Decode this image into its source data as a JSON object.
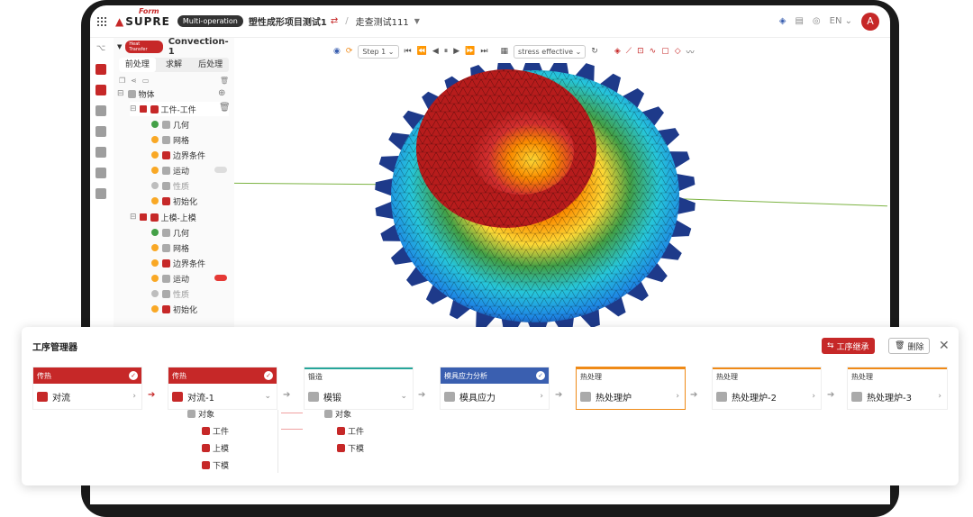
{
  "topbar": {
    "logo_text": "SUPRE",
    "logo_form": "Form",
    "mode_badge": "Multi-operation",
    "project_name": "塑性成形项目测试1",
    "case_name": "走查测试111",
    "language": "EN",
    "avatar_letter": "A"
  },
  "panel": {
    "badge": "Heat Transfer",
    "name": "Convection-1",
    "tabs": [
      "前处理",
      "求解",
      "后处理"
    ],
    "root_label": "物体",
    "workpiece": {
      "label": "工件-工件",
      "items": [
        {
          "label": "几何",
          "status": "ok"
        },
        {
          "label": "网格",
          "status": "warn"
        },
        {
          "label": "边界条件",
          "status": "warn"
        },
        {
          "label": "运动",
          "status": "warn",
          "toggle": false
        },
        {
          "label": "性质",
          "status": "off"
        },
        {
          "label": "初始化",
          "status": "warn"
        }
      ]
    },
    "upper_die": {
      "label": "上模-上模",
      "items": [
        {
          "label": "几何",
          "status": "ok"
        },
        {
          "label": "网格",
          "status": "warn"
        },
        {
          "label": "边界条件",
          "status": "warn"
        },
        {
          "label": "运动",
          "status": "warn",
          "toggle": true
        },
        {
          "label": "性质",
          "status": "off"
        },
        {
          "label": "初始化",
          "status": "warn"
        }
      ]
    }
  },
  "viewer": {
    "step": "Step 1",
    "result_field": "stress effective"
  },
  "process_manager": {
    "title": "工序管理器",
    "inherit_label": "工序继承",
    "delete_label": "删除",
    "cards": [
      {
        "category": "传热",
        "name": "对流",
        "style": "red",
        "checked": true,
        "arrow": "›"
      },
      {
        "category": "传热",
        "name": "对流-1",
        "style": "red",
        "checked": true,
        "arrow": "⌄",
        "children": {
          "group": "对象",
          "items": [
            "工件",
            "上模",
            "下模"
          ]
        }
      },
      {
        "category": "锻造",
        "name": "模锻",
        "style": "greenb",
        "checked": false,
        "arrow": "⌄",
        "children": {
          "group": "对象",
          "items": [
            "工件",
            "下模"
          ]
        }
      },
      {
        "category": "模具应力分析",
        "name": "模具应力",
        "style": "blue",
        "checked": true,
        "arrow": "›"
      },
      {
        "category": "热处理",
        "name": "热处理炉",
        "style": "orangeb",
        "checked": false,
        "arrow": "›"
      },
      {
        "category": "热处理",
        "name": "热处理炉-2",
        "style": "orangeb",
        "checked": false,
        "arrow": "›"
      },
      {
        "category": "热处理",
        "name": "热处理炉-3",
        "style": "orangeb",
        "checked": false,
        "arrow": "›"
      }
    ]
  },
  "colors": {
    "brand_red": "#c62828",
    "blue": "#3a5fb0",
    "teal": "#26a69a",
    "orange": "#ef8a17"
  }
}
